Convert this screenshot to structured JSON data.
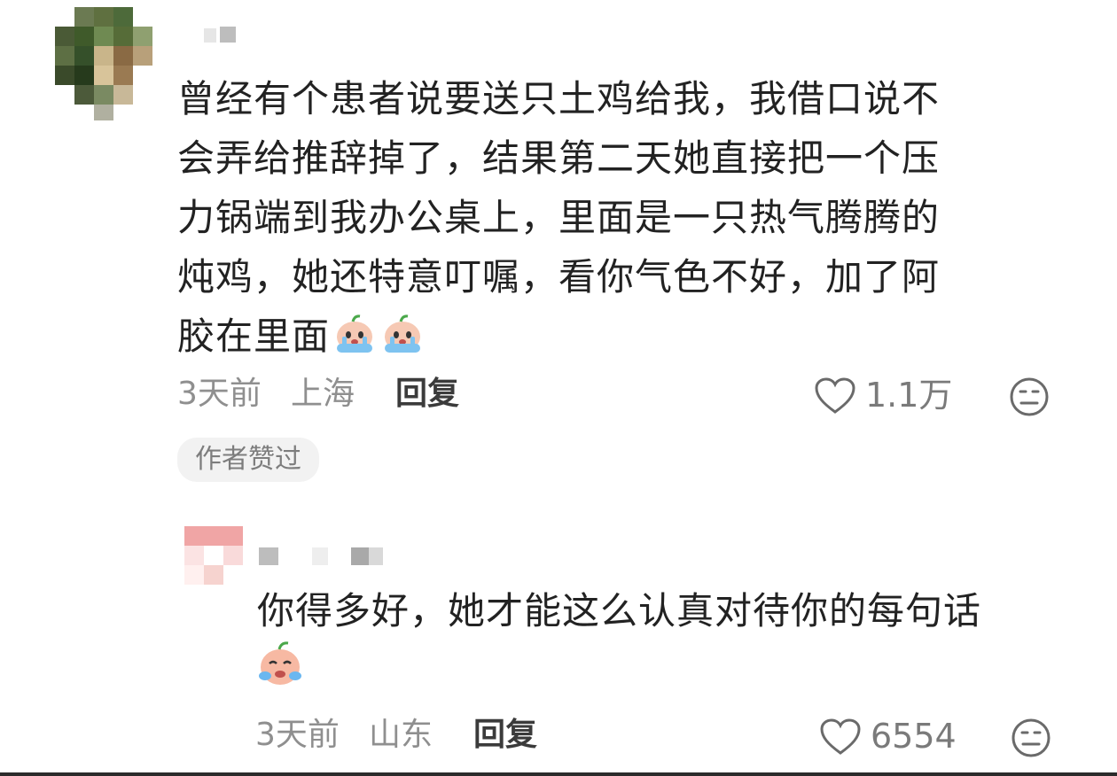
{
  "comment": {
    "text_lines": [
      "曾经有个患者说要送只土鸡给我，我借口说不",
      "会弄给推辞掉了，结果第二天她直接把一个压",
      "力锅端到我办公桌上，里面是一只热气腾腾的",
      "炖鸡，她还特意叮嘱，看你气色不好，加了阿",
      "胶在里面"
    ],
    "emoji": [
      "crying-face-emoji",
      "crying-face-emoji"
    ],
    "time": "3天前",
    "location": "上海",
    "reply_label": "回复",
    "like_count": "1.1万",
    "author_liked_badge": "作者赞过"
  },
  "reply": {
    "text_line": "你得多好，她才能这么认真对待你的每句话",
    "emoji": [
      "crying-face-emoji"
    ],
    "time": "3天前",
    "location": "山东",
    "reply_label": "回复",
    "like_count": "6554"
  },
  "colors": {
    "text": "#222222",
    "meta": "#8f8f8f",
    "badge_bg": "#f2f2f2"
  }
}
